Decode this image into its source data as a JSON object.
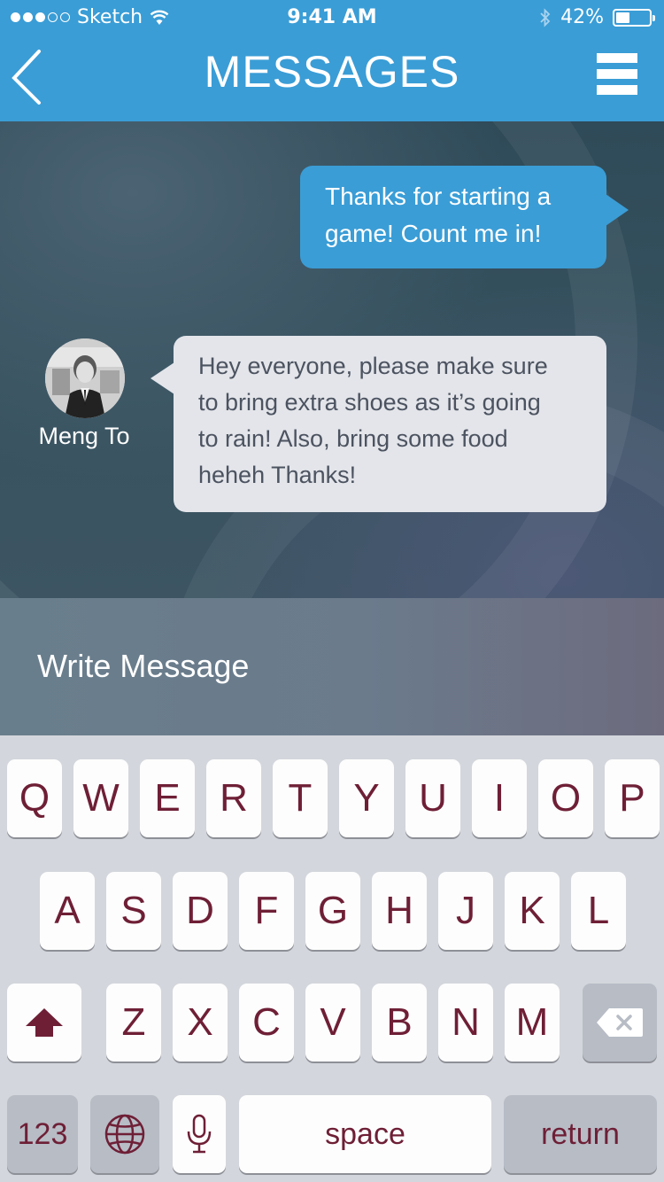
{
  "status_bar": {
    "carrier": "Sketch",
    "time": "9:41 AM",
    "battery": "42%",
    "battery_level": 0.42
  },
  "nav": {
    "title": "MESSAGES",
    "back_icon": "chevron-left-icon",
    "menu_icon": "hamburger-menu-icon"
  },
  "messages": [
    {
      "direction": "outgoing",
      "text_lines": [
        "Thanks for starting a",
        "game! Count me in!"
      ]
    },
    {
      "direction": "incoming",
      "sender": "Meng To",
      "text_lines": [
        "Hey everyone, please make sure",
        "to bring extra shoes as it’s going",
        "to rain! Also, bring some food",
        "heheh Thanks!"
      ]
    }
  ],
  "composer": {
    "placeholder": "Write Message"
  },
  "keyboard": {
    "row1": [
      "Q",
      "W",
      "E",
      "R",
      "T",
      "Y",
      "U",
      "I",
      "O",
      "P"
    ],
    "row2": [
      "A",
      "S",
      "D",
      "F",
      "G",
      "H",
      "J",
      "K",
      "L"
    ],
    "row3": [
      "Z",
      "X",
      "C",
      "V",
      "B",
      "N",
      "M"
    ],
    "numbers_label": "123",
    "space_label": "space",
    "return_label": "return"
  },
  "colors": {
    "accent": "#3a9dd6",
    "key_text": "#6e1f36"
  }
}
